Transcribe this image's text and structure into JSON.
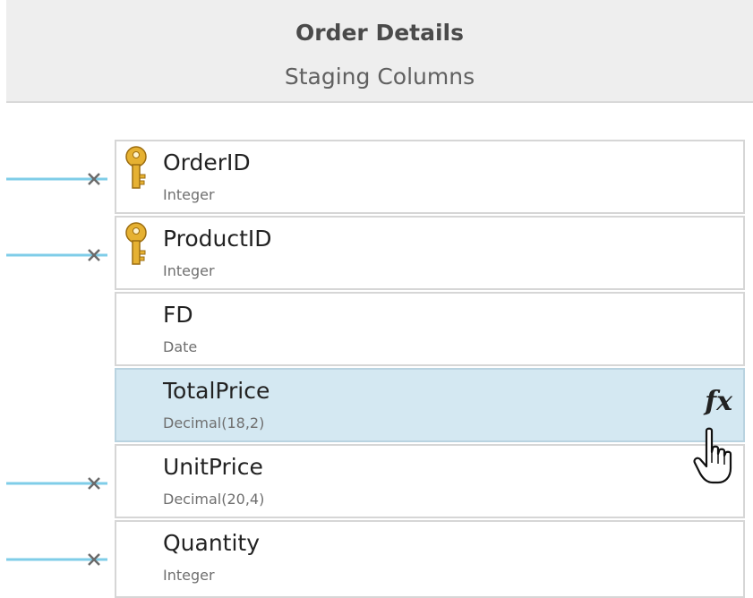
{
  "header": {
    "title": "Order Details",
    "subtitle": "Staging Columns"
  },
  "columns": [
    {
      "name": "OrderID",
      "type": "Integer",
      "key": true,
      "mapped": true
    },
    {
      "name": "ProductID",
      "type": "Integer",
      "key": true,
      "mapped": true
    },
    {
      "name": "FD",
      "type": "Date",
      "key": false,
      "mapped": false
    },
    {
      "name": "TotalPrice",
      "type": "Decimal(18,2)",
      "key": false,
      "mapped": false,
      "selected": true,
      "expression_icon": "fx"
    },
    {
      "name": "UnitPrice",
      "type": "Decimal(20,4)",
      "key": false,
      "mapped": true
    },
    {
      "name": "Quantity",
      "type": "Integer",
      "key": false,
      "mapped": true
    }
  ],
  "colors": {
    "connector_line": "#7fcde8",
    "selected_row": "#d4e8f2",
    "key_gold": "#e0a92a"
  },
  "icons": {
    "key": "key-icon",
    "expression": "fx-icon",
    "cursor": "hand-pointer-icon",
    "unlink": "unlink-x-icon"
  }
}
